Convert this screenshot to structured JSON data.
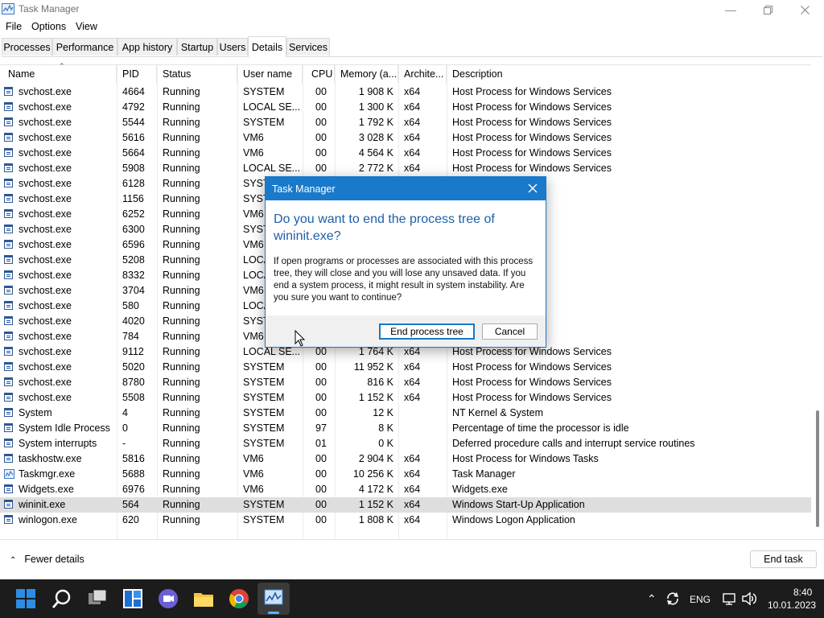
{
  "window": {
    "title": "Task Manager"
  },
  "menu": [
    "File",
    "Options",
    "View"
  ],
  "tabs": [
    {
      "label": "Processes"
    },
    {
      "label": "Performance"
    },
    {
      "label": "App history"
    },
    {
      "label": "Startup"
    },
    {
      "label": "Users"
    },
    {
      "label": "Details",
      "active": true
    },
    {
      "label": "Services"
    }
  ],
  "columns": [
    "Name",
    "PID",
    "Status",
    "User name",
    "CPU",
    "Memory (a...",
    "Archite...",
    "Description"
  ],
  "rows": [
    {
      "name": "svchost.exe",
      "pid": "4664",
      "status": "Running",
      "user": "SYSTEM",
      "cpu": "00",
      "mem": "1 908 K",
      "arch": "x64",
      "desc": "Host Process for Windows Services"
    },
    {
      "name": "svchost.exe",
      "pid": "4792",
      "status": "Running",
      "user": "LOCAL SE...",
      "cpu": "00",
      "mem": "1 300 K",
      "arch": "x64",
      "desc": "Host Process for Windows Services"
    },
    {
      "name": "svchost.exe",
      "pid": "5544",
      "status": "Running",
      "user": "SYSTEM",
      "cpu": "00",
      "mem": "1 792 K",
      "arch": "x64",
      "desc": "Host Process for Windows Services"
    },
    {
      "name": "svchost.exe",
      "pid": "5616",
      "status": "Running",
      "user": "VM6",
      "cpu": "00",
      "mem": "3 028 K",
      "arch": "x64",
      "desc": "Host Process for Windows Services"
    },
    {
      "name": "svchost.exe",
      "pid": "5664",
      "status": "Running",
      "user": "VM6",
      "cpu": "00",
      "mem": "4 564 K",
      "arch": "x64",
      "desc": "Host Process for Windows Services"
    },
    {
      "name": "svchost.exe",
      "pid": "5908",
      "status": "Running",
      "user": "LOCAL SE...",
      "cpu": "00",
      "mem": "2 772 K",
      "arch": "x64",
      "desc": "Host Process for Windows Services"
    },
    {
      "name": "svchost.exe",
      "pid": "6128",
      "status": "Running",
      "user": "SYST",
      "cpu": "",
      "mem": "",
      "arch": "",
      "desc": "ows Services"
    },
    {
      "name": "svchost.exe",
      "pid": "1156",
      "status": "Running",
      "user": "SYST",
      "cpu": "",
      "mem": "",
      "arch": "",
      "desc": "ows Services"
    },
    {
      "name": "svchost.exe",
      "pid": "6252",
      "status": "Running",
      "user": "VM6",
      "cpu": "",
      "mem": "",
      "arch": "",
      "desc": "ows Services"
    },
    {
      "name": "svchost.exe",
      "pid": "6300",
      "status": "Running",
      "user": "SYST",
      "cpu": "",
      "mem": "",
      "arch": "",
      "desc": "ows Services"
    },
    {
      "name": "svchost.exe",
      "pid": "6596",
      "status": "Running",
      "user": "VM6",
      "cpu": "",
      "mem": "",
      "arch": "",
      "desc": "ows Services"
    },
    {
      "name": "svchost.exe",
      "pid": "5208",
      "status": "Running",
      "user": "LOCA",
      "cpu": "",
      "mem": "",
      "arch": "",
      "desc": "ows Services"
    },
    {
      "name": "svchost.exe",
      "pid": "8332",
      "status": "Running",
      "user": "LOCA",
      "cpu": "",
      "mem": "",
      "arch": "",
      "desc": "ows Services"
    },
    {
      "name": "svchost.exe",
      "pid": "3704",
      "status": "Running",
      "user": "VM6",
      "cpu": "",
      "mem": "",
      "arch": "",
      "desc": "ows Services"
    },
    {
      "name": "svchost.exe",
      "pid": "580",
      "status": "Running",
      "user": "LOCA",
      "cpu": "",
      "mem": "",
      "arch": "",
      "desc": "ows Services"
    },
    {
      "name": "svchost.exe",
      "pid": "4020",
      "status": "Running",
      "user": "SYST",
      "cpu": "",
      "mem": "",
      "arch": "",
      "desc": "ows Services"
    },
    {
      "name": "svchost.exe",
      "pid": "784",
      "status": "Running",
      "user": "VM6",
      "cpu": "",
      "mem": "",
      "arch": "",
      "desc": "ows Services"
    },
    {
      "name": "svchost.exe",
      "pid": "9112",
      "status": "Running",
      "user": "LOCAL SE...",
      "cpu": "00",
      "mem": "1 764 K",
      "arch": "x64",
      "desc": "Host Process for Windows Services"
    },
    {
      "name": "svchost.exe",
      "pid": "5020",
      "status": "Running",
      "user": "SYSTEM",
      "cpu": "00",
      "mem": "11 952 K",
      "arch": "x64",
      "desc": "Host Process for Windows Services"
    },
    {
      "name": "svchost.exe",
      "pid": "8780",
      "status": "Running",
      "user": "SYSTEM",
      "cpu": "00",
      "mem": "816 K",
      "arch": "x64",
      "desc": "Host Process for Windows Services"
    },
    {
      "name": "svchost.exe",
      "pid": "5508",
      "status": "Running",
      "user": "SYSTEM",
      "cpu": "00",
      "mem": "1 152 K",
      "arch": "x64",
      "desc": "Host Process for Windows Services"
    },
    {
      "name": "System",
      "pid": "4",
      "status": "Running",
      "user": "SYSTEM",
      "cpu": "00",
      "mem": "12 K",
      "arch": "",
      "desc": "NT Kernel & System"
    },
    {
      "name": "System Idle Process",
      "pid": "0",
      "status": "Running",
      "user": "SYSTEM",
      "cpu": "97",
      "mem": "8 K",
      "arch": "",
      "desc": "Percentage of time the processor is idle"
    },
    {
      "name": "System interrupts",
      "pid": "-",
      "status": "Running",
      "user": "SYSTEM",
      "cpu": "01",
      "mem": "0 K",
      "arch": "",
      "desc": "Deferred procedure calls and interrupt service routines"
    },
    {
      "name": "taskhostw.exe",
      "pid": "5816",
      "status": "Running",
      "user": "VM6",
      "cpu": "00",
      "mem": "2 904 K",
      "arch": "x64",
      "desc": "Host Process for Windows Tasks"
    },
    {
      "name": "Taskmgr.exe",
      "pid": "5688",
      "status": "Running",
      "user": "VM6",
      "cpu": "00",
      "mem": "10 256 K",
      "arch": "x64",
      "desc": "Task Manager",
      "icon": "taskmgr"
    },
    {
      "name": "Widgets.exe",
      "pid": "6976",
      "status": "Running",
      "user": "VM6",
      "cpu": "00",
      "mem": "4 172 K",
      "arch": "x64",
      "desc": "Widgets.exe"
    },
    {
      "name": "wininit.exe",
      "pid": "564",
      "status": "Running",
      "user": "SYSTEM",
      "cpu": "00",
      "mem": "1 152 K",
      "arch": "x64",
      "desc": "Windows Start-Up Application",
      "selected": true
    },
    {
      "name": "winlogon.exe",
      "pid": "620",
      "status": "Running",
      "user": "SYSTEM",
      "cpu": "00",
      "mem": "1 808 K",
      "arch": "x64",
      "desc": "Windows Logon Application"
    }
  ],
  "footer": {
    "fewer_details": "Fewer details",
    "end_task": "End task"
  },
  "dialog": {
    "title": "Task Manager",
    "heading": "Do you want to end the process tree of wininit.exe?",
    "body": "If open programs or processes are associated with this process tree, they will close and you will lose any unsaved data. If you end a system process, it might result in system instability. Are you sure you want to continue?",
    "primary": "End process tree",
    "cancel": "Cancel"
  },
  "tray": {
    "lang": "ENG",
    "time": "8:40",
    "date": "10.01.2023"
  },
  "colors": {
    "accent": "#1979ca",
    "taskbar": "#1c1c1c",
    "selected_row": "#dedede"
  }
}
